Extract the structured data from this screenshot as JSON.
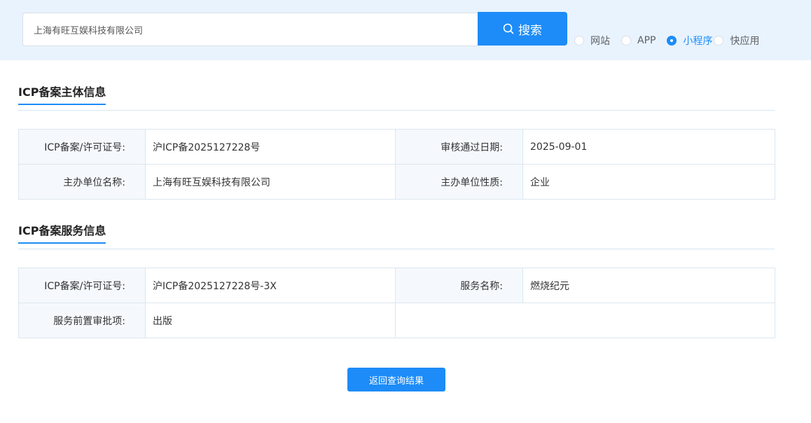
{
  "search": {
    "value": "上海有旺互娱科技有限公司",
    "button_label": "搜索",
    "types": [
      {
        "label": "网站",
        "checked": false
      },
      {
        "label": "APP",
        "checked": false
      },
      {
        "label": "小程序",
        "checked": true
      },
      {
        "label": "快应用",
        "checked": false
      }
    ]
  },
  "subject": {
    "title": "ICP备案主体信息",
    "rows": [
      {
        "l1": "ICP备案/许可证号:",
        "v1": "沪ICP备2025127228号",
        "l2": "审核通过日期:",
        "v2": "2025-09-01"
      },
      {
        "l1": "主办单位名称:",
        "v1": "上海有旺互娱科技有限公司",
        "l2": "主办单位性质:",
        "v2": "企业"
      }
    ]
  },
  "service": {
    "title": "ICP备案服务信息",
    "rows": [
      {
        "l1": "ICP备案/许可证号:",
        "v1": "沪ICP备2025127228号-3X",
        "l2": "服务名称:",
        "v2": "燃烧纪元"
      },
      {
        "l1": "服务前置审批项:",
        "v1": "出版"
      }
    ]
  },
  "back_button_label": "返回查询结果",
  "colors": {
    "accent": "#1d8cf8",
    "header_bg": "#e8f3fe",
    "label_bg": "#f5f9fd",
    "border": "#dce6ef"
  }
}
